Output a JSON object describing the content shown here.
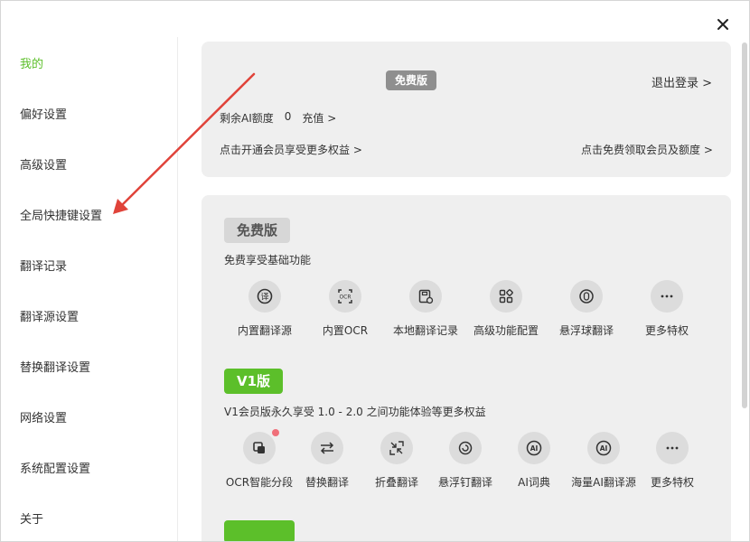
{
  "sidebar": {
    "items": [
      {
        "label": "我的",
        "active": true
      },
      {
        "label": "偏好设置"
      },
      {
        "label": "高级设置"
      },
      {
        "label": "全局快捷键设置"
      },
      {
        "label": "翻译记录"
      },
      {
        "label": "翻译源设置"
      },
      {
        "label": "替换翻译设置"
      },
      {
        "label": "网络设置"
      },
      {
        "label": "系统配置设置"
      },
      {
        "label": "关于"
      }
    ]
  },
  "account": {
    "plan_badge": "免费版",
    "logout": "退出登录 >",
    "quota_label": "剩余AI额度",
    "quota_value": "0",
    "recharge": "充值 >",
    "upgrade_link": "点击开通会员享受更多权益 >",
    "free_vip_link": "点击免费领取会员及额度 >"
  },
  "plans": {
    "free": {
      "badge": "免费版",
      "desc": "免费享受基础功能",
      "features": [
        "内置翻译源",
        "内置OCR",
        "本地翻译记录",
        "高级功能配置",
        "悬浮球翻译",
        "更多特权"
      ]
    },
    "v1": {
      "badge": "V1版",
      "desc": "V1会员版永久享受 1.0 - 2.0 之间功能体验等更多权益",
      "features": [
        "OCR智能分段",
        "替换翻译",
        "折叠翻译",
        "悬浮钉翻译",
        "AI词典",
        "海量AI翻译源",
        "更多特权"
      ]
    }
  },
  "colors": {
    "accent": "#5cbf2a",
    "annotation_arrow": "#e0433a",
    "notify_dot": "#f0707a"
  }
}
